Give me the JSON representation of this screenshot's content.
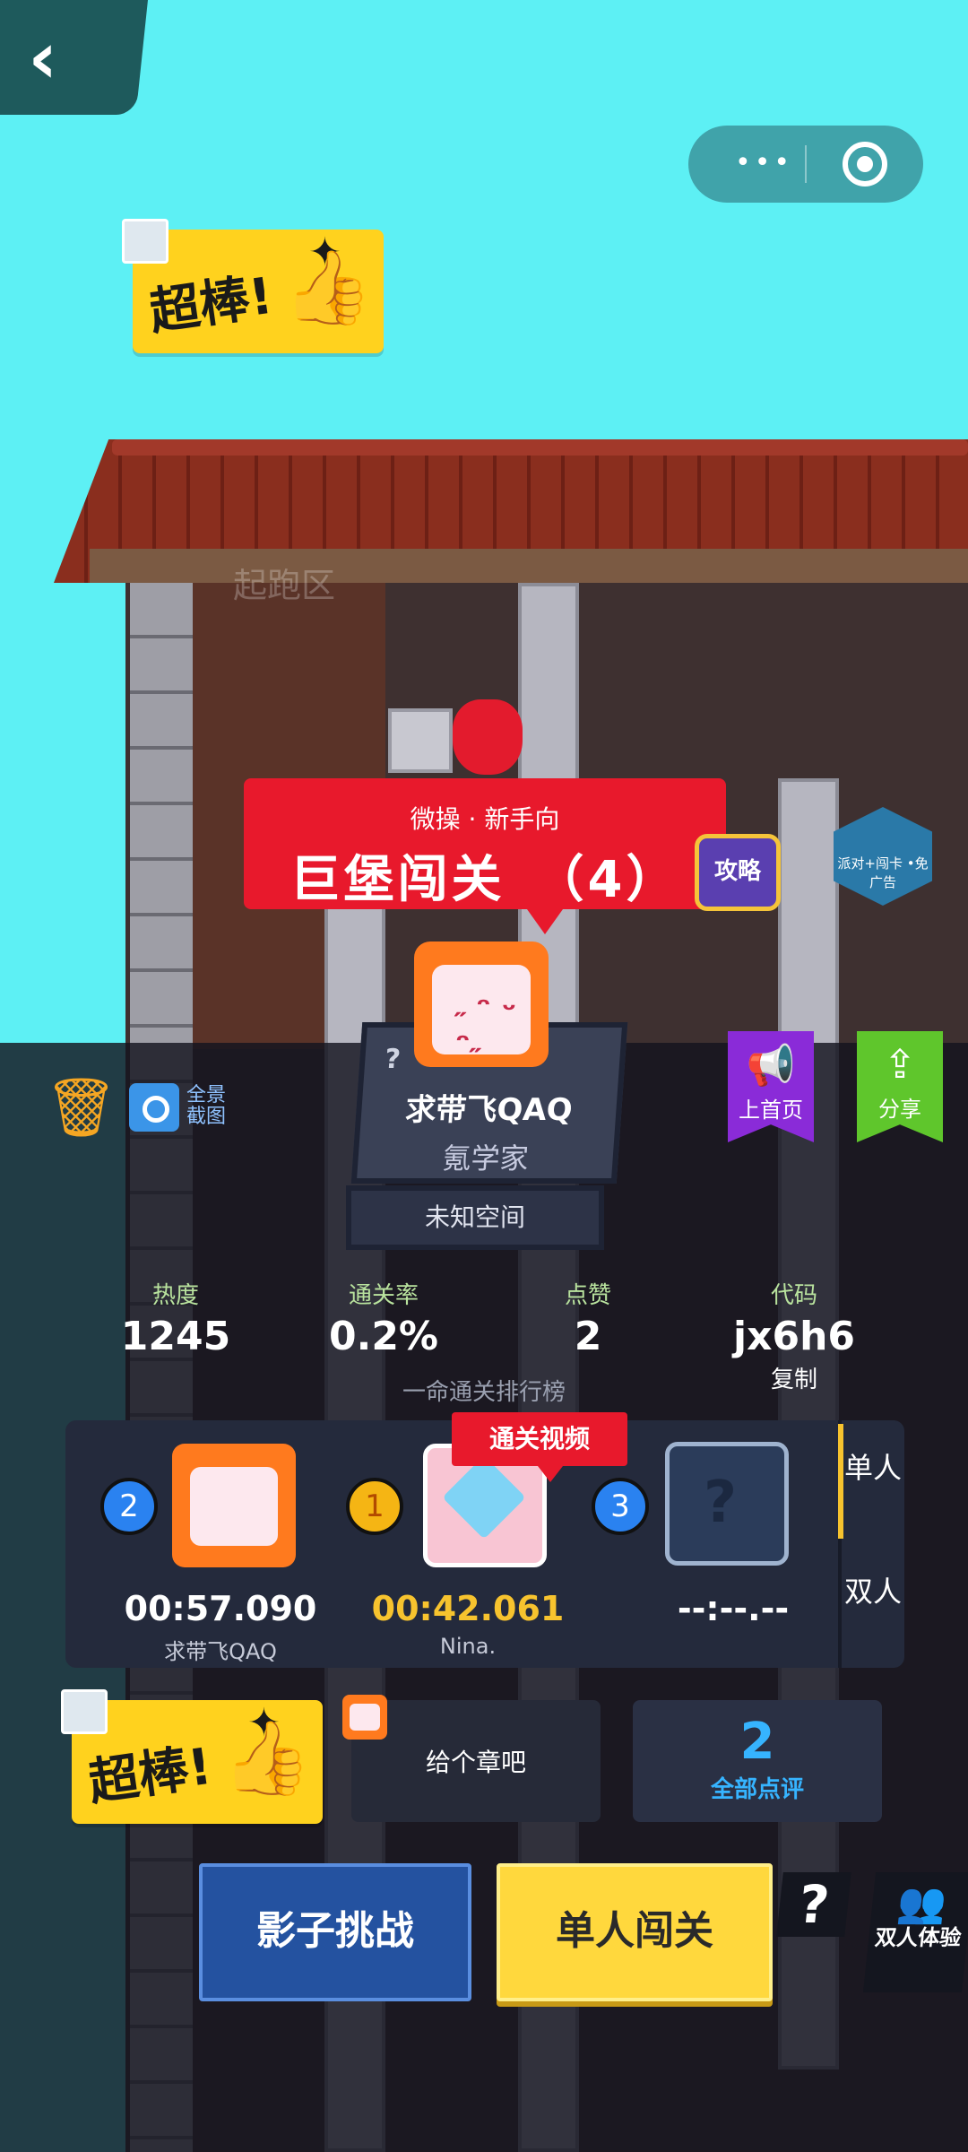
{
  "nav": {
    "back_glyph": "‹",
    "menu_dots": "•••"
  },
  "scene": {
    "spawn_zone_label": "起跑区"
  },
  "sticker": {
    "text": "超棒!",
    "thumb_icon": "thumbs-up-icon"
  },
  "level": {
    "category": "微操 · 新手向",
    "title": "巨堡闯关　（4）",
    "guide_label": "攻略",
    "promo_label": "派对+闯卡 •免广告"
  },
  "author": {
    "name": "求带飞QAQ",
    "title": "氪学家",
    "space": "未知空间",
    "unknown_mark": "?"
  },
  "tools": {
    "screenshot_label": "全景截图"
  },
  "actions": {
    "home_label": "上首页",
    "share_label": "分享"
  },
  "stats": {
    "heat_label": "热度",
    "heat_value": "1245",
    "clear_rate_label": "通关率",
    "clear_rate_value": "0.2%",
    "likes_label": "点赞",
    "likes_value": "2",
    "code_label": "代码",
    "code_value": "jx6h6",
    "copy_label": "复制"
  },
  "leaderboard": {
    "title": "一命通关排行榜",
    "video_tag": "通关视频",
    "tab_single": "单人",
    "tab_double": "双人",
    "entries": [
      {
        "rank": "2",
        "time": "00:57.090",
        "name": "求带飞QAQ"
      },
      {
        "rank": "1",
        "time": "00:42.061",
        "name": "Nina."
      },
      {
        "rank": "3",
        "time": "--:--.--",
        "name": ""
      }
    ]
  },
  "comment": {
    "text": "给个章吧",
    "review_count": "2",
    "review_label": "全部点评"
  },
  "buttons": {
    "shadow_challenge": "影子挑战",
    "single_play": "单人闯关",
    "help": "?",
    "duo_label": "双人体验"
  },
  "colors": {
    "sky": "#5df0f4",
    "banner_red": "#e8192c",
    "gold": "#f7c32e",
    "review_blue": "#36b4ff"
  }
}
